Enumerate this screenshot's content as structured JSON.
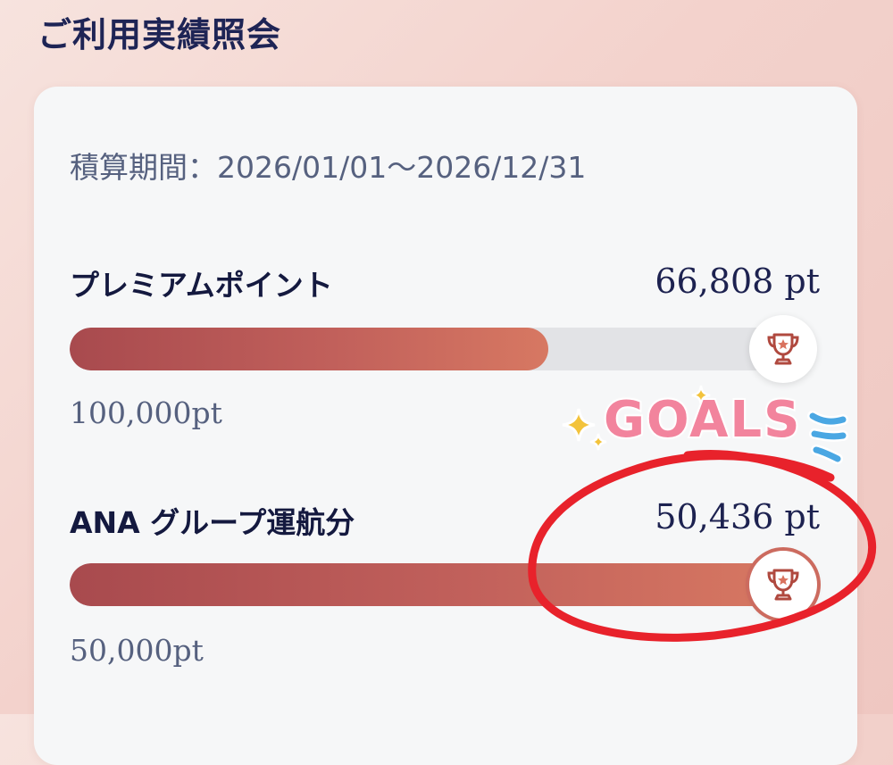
{
  "header": {
    "title": "ご利用実績照会"
  },
  "card": {
    "period_label": "積算期間：2026/01/01～2026/12/31",
    "metrics": [
      {
        "label": "プレミアムポイント",
        "value": "66,808 pt",
        "goal": "100,000pt",
        "progress_fraction": 0.67,
        "achieved": false
      },
      {
        "label": "ANA グループ運航分",
        "value": "50,436 pt",
        "goal": "50,000pt",
        "progress_fraction": 1.0,
        "achieved": true
      }
    ]
  },
  "overlay": {
    "sticker_text": "GOALS",
    "sticker_color": "#f2849d",
    "circle_color": "#e8222b",
    "sparkle_color": "#f3c33b",
    "drops_color": "#4aa7e3"
  },
  "colors": {
    "bar_start": "#a84a4e",
    "bar_end": "#d77862",
    "navy": "#1e2455",
    "muted": "#56617f"
  },
  "icons": {
    "badge": "trophy-star-icon"
  }
}
